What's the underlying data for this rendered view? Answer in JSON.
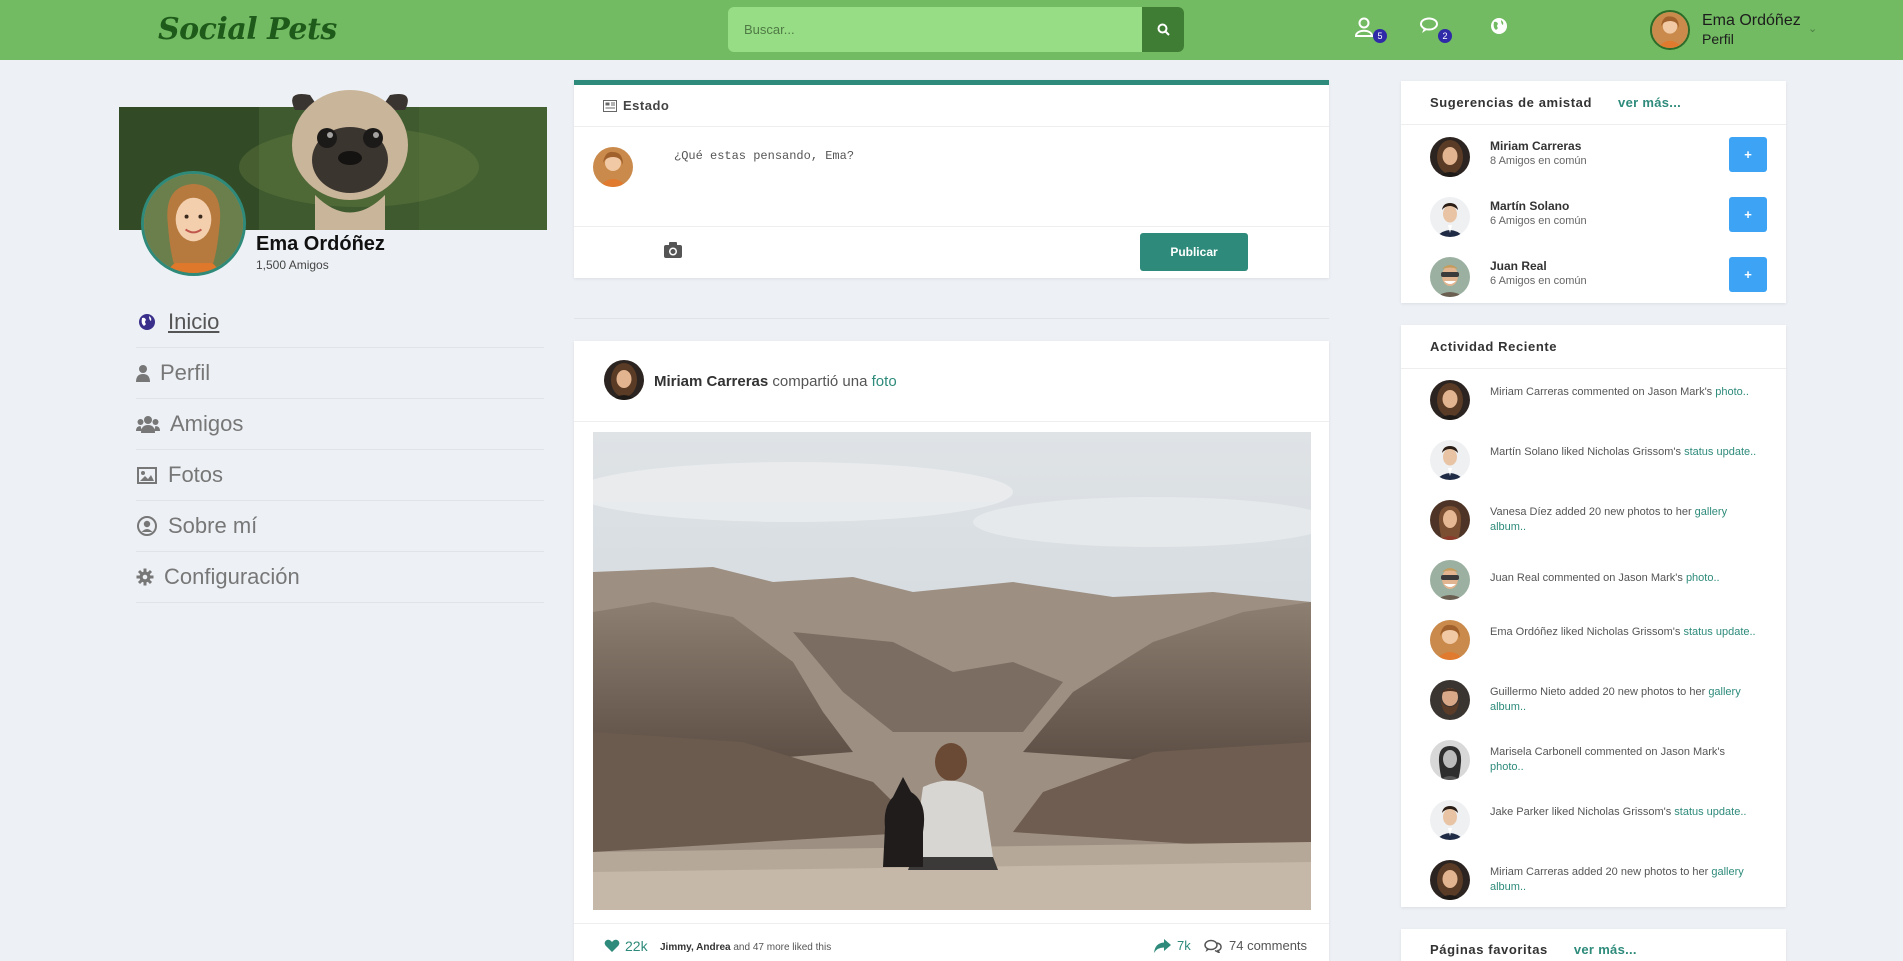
{
  "header": {
    "logo": "Social Pets",
    "search_placeholder": "Buscar...",
    "friend_requests_count": "5",
    "messages_count": "2",
    "user_name": "Ema Ordóñez",
    "user_role": "Perfil"
  },
  "profile": {
    "name": "Ema Ordóñez",
    "friends": "1,500 Amigos"
  },
  "menu": [
    {
      "label": "Inicio",
      "icon": "globe-icon"
    },
    {
      "label": "Perfil",
      "icon": "user-icon"
    },
    {
      "label": "Amigos",
      "icon": "users-icon"
    },
    {
      "label": "Fotos",
      "icon": "image-icon"
    },
    {
      "label": "Sobre mí",
      "icon": "user-circle-icon"
    },
    {
      "label": "Configuración",
      "icon": "gear-icon"
    }
  ],
  "status": {
    "title": "Estado",
    "placeholder": "¿Qué estas pensando, Ema?",
    "publish_label": "Publicar"
  },
  "post": {
    "author": "Miriam Carreras",
    "verb": "compartió una",
    "object": "foto",
    "likes": "22k",
    "liked_by_names": "Jimmy, Andrea",
    "liked_by_rest": "and 47 more liked this",
    "shares": "7k",
    "comments": "74 comments"
  },
  "suggestions": {
    "title": "Sugerencias de amistad",
    "more": "ver más...",
    "items": [
      {
        "name": "Miriam Carreras",
        "mutual": "8 Amigos en común",
        "add": "+"
      },
      {
        "name": "Martín Solano",
        "mutual": "6 Amigos en común",
        "add": "+"
      },
      {
        "name": "Juan Real",
        "mutual": "6 Amigos en común",
        "add": "+"
      }
    ]
  },
  "activity": {
    "title": "Actividad Reciente",
    "items": [
      {
        "text": "Miriam Carreras commented on Jason Mark's",
        "link": "photo.."
      },
      {
        "text": "Martín Solano liked Nicholas Grissom's",
        "link": "status update.."
      },
      {
        "text": "Vanesa Díez added 20 new photos to her",
        "link": "gallery album.."
      },
      {
        "text": "Juan Real commented on Jason Mark's",
        "link": "photo.."
      },
      {
        "text": "Ema Ordóñez liked Nicholas Grissom's",
        "link": "status update.."
      },
      {
        "text": "Guillermo Nieto added 20 new photos to her",
        "link": "gallery album.."
      },
      {
        "text": "Marisela Carbonell commented on Jason Mark's",
        "link": "photo.."
      },
      {
        "text": "Jake Parker liked Nicholas Grissom's",
        "link": "status update.."
      },
      {
        "text": "Miriam Carreras added 20 new photos to her",
        "link": "gallery album.."
      }
    ]
  },
  "pages": {
    "title": "Páginas favoritas",
    "more": "ver más..."
  },
  "colors": {
    "topbar": "#72bb62",
    "accent": "#2e8b7b",
    "add_button": "#3da4f5",
    "badge": "#2f2aa8"
  }
}
